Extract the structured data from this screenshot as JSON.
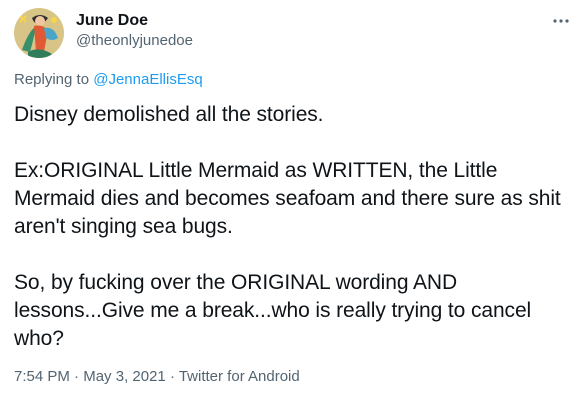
{
  "user": {
    "display_name": "June Doe",
    "handle": "@theonlyjunedoe"
  },
  "reply": {
    "prefix": "Replying to ",
    "mention": "@JennaEllisEsq"
  },
  "tweet": {
    "paragraphs": [
      "Disney demolished all the stories.",
      "Ex:ORIGINAL Little Mermaid as WRITTEN, the Little Mermaid dies and becomes seafoam and there sure as shit aren't singing sea bugs.",
      "So, by fucking over the ORIGINAL wording AND lessons...Give me a break...who is really trying to cancel who?"
    ]
  },
  "meta": {
    "time": "7:54 PM",
    "sep1": " · ",
    "date": "May 3, 2021",
    "sep2": " · ",
    "source": "Twitter for Android"
  },
  "icons": {
    "more": "more-horizontal-icon",
    "avatar": "avatar-image"
  },
  "colors": {
    "text": "#0f1419",
    "secondary": "#536471",
    "link": "#1d9bf0"
  }
}
